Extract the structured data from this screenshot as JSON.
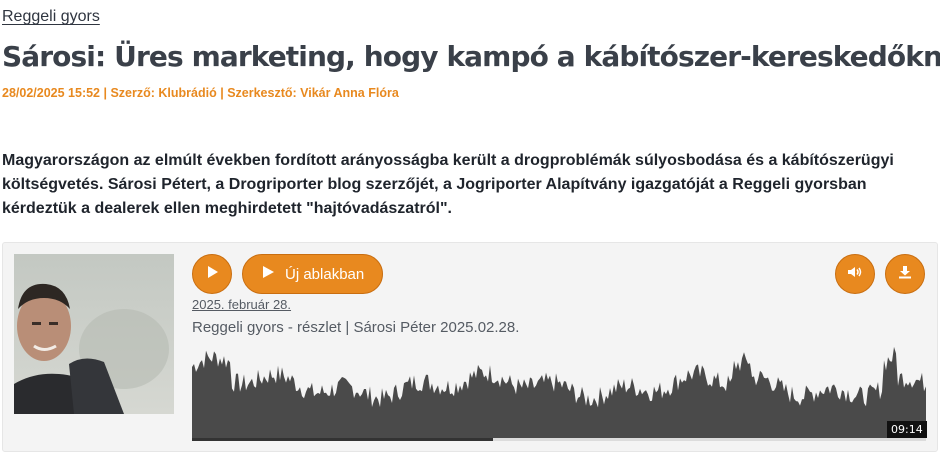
{
  "category": "Reggeli gyors",
  "title": "Sárosi: Üres marketing, hogy kampó a kábítószer-kereskedőknek",
  "meta": {
    "date": "28/02/2025 15:52",
    "author": "| Szerző: Klubrádió",
    "editor": "| Szerkesztő: Vikár Anna Flóra"
  },
  "lead": "Magyarországon az elmúlt években fordított arányosságba került a drogproblémák súlyosbodása és a kábítószerügyi költségvetés. Sárosi Pétert, a Drogriporter blog szerzőjét, a Jogriporter Alapítvány igazgatóját a Reggeli gyorsban kérdeztük a dealerek ellen meghirdetett \"hajtóvadászatról\".",
  "player": {
    "open_window_label": "Új ablakban",
    "date": "2025. február 28.",
    "episode_title": "Reggeli gyors - részlet | Sárosi Péter 2025.02.28.",
    "duration": "09:14",
    "progress": 0.41,
    "icons": {
      "play": "play-icon",
      "open_window": "play-icon",
      "volume": "volume-icon",
      "download": "download-icon"
    },
    "accent_color": "#e8891f"
  }
}
